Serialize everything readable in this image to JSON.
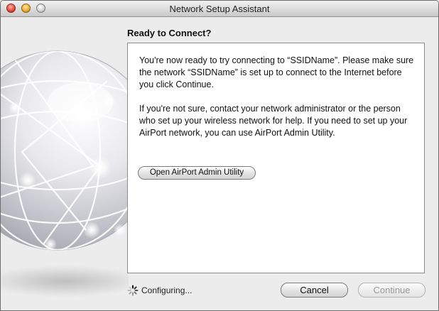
{
  "window": {
    "title": "Network Setup Assistant"
  },
  "content": {
    "heading": "Ready to Connect?",
    "paragraph_1": "You're now ready to try connecting to “SSIDName”. Please make sure the network “SSIDName” is set up to connect to the Internet before you click Continue.",
    "paragraph_2": "If you're not sure, contact your network administrator or the person who set up your wireless network for help. If you need to set up your AirPort network, you can use AirPort Admin Utility.",
    "admin_button_label": "Open AirPort Admin Utility"
  },
  "footer": {
    "status_text": "Configuring...",
    "cancel_label": "Cancel",
    "continue_label": "Continue"
  },
  "icons": {
    "close": "close-button-red",
    "minimize": "minimize-button-yellow",
    "zoom": "zoom-button-gray",
    "globe": "network-globe",
    "spinner": "progress-spinner"
  }
}
